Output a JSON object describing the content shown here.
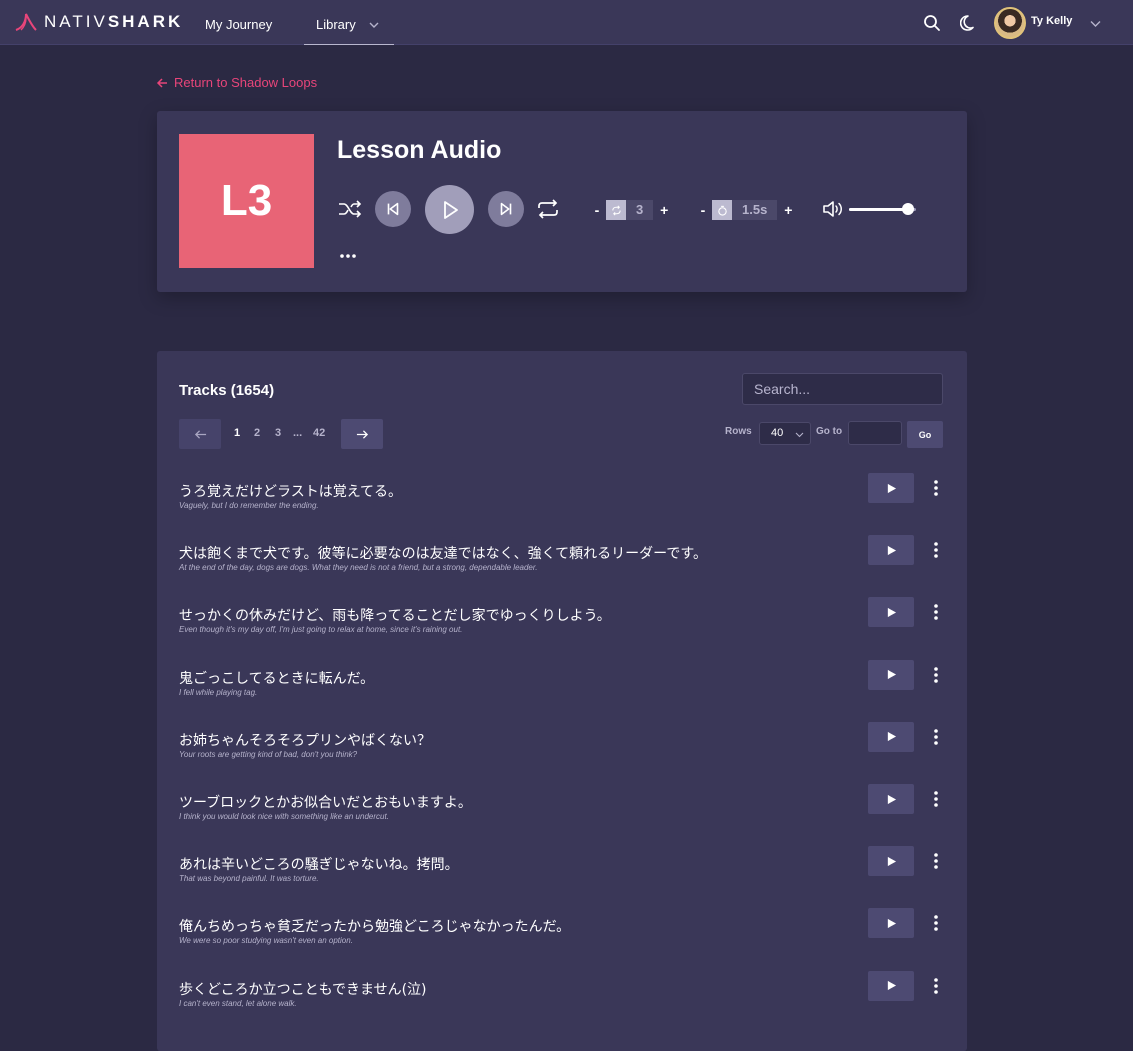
{
  "brand": {
    "light": "NATIV",
    "bold": "SHARK",
    "accent": "#e8457a"
  },
  "nav": {
    "journey": "My Journey",
    "library": "Library",
    "user_name": "Ty Kelly"
  },
  "back_link": "Return to Shadow Loops",
  "player": {
    "cover_label": "L3",
    "cover_color": "#e86476",
    "title": "Lesson Audio",
    "loop": {
      "minus": "-",
      "value": "3",
      "plus": "+"
    },
    "delay": {
      "minus": "-",
      "value": "1.5s",
      "plus": "+"
    },
    "volume_level": 0.88
  },
  "tracks": {
    "title": "Tracks (1654)",
    "search_placeholder": "Search...",
    "pagination": {
      "pages": [
        "1",
        "2",
        "3",
        "...",
        "42"
      ],
      "current": "1"
    },
    "rows_label": "Rows",
    "rows_value": "40",
    "goto_label": "Go to",
    "go_button": "Go",
    "items": [
      {
        "jp": "うろ覚えだけどラストは覚えてる。",
        "en": "Vaguely, but I do remember the ending."
      },
      {
        "jp": "犬は飽くまで犬です。彼等に必要なのは友達ではなく、強くて頼れるリーダーです。",
        "en": "At the end of the day, dogs are dogs. What they need is not a friend, but a strong, dependable leader."
      },
      {
        "jp": "せっかくの休みだけど、雨も降ってることだし家でゆっくりしよう。",
        "en": "Even though it's my day off, I'm just going to relax at home, since it's raining out."
      },
      {
        "jp": "鬼ごっこしてるときに転んだ。",
        "en": "I fell while playing tag."
      },
      {
        "jp": "お姉ちゃんそろそろプリンやばくない？",
        "en": "Your roots are getting kind of bad, don't you think?"
      },
      {
        "jp": "ツーブロックとかお似合いだとおもいますよ。",
        "en": "I think you would look nice with something like an undercut."
      },
      {
        "jp": "あれは辛いどころの騒ぎじゃないね。拷問。",
        "en": "That was beyond painful. It was torture."
      },
      {
        "jp": "俺んちめっちゃ貧乏だったから勉強どころじゃなかったんだ。",
        "en": "We were so poor studying wasn't even an option."
      },
      {
        "jp": "歩くどころか立つこともできません(泣)",
        "en": "I can't even stand, let alone walk."
      }
    ]
  }
}
